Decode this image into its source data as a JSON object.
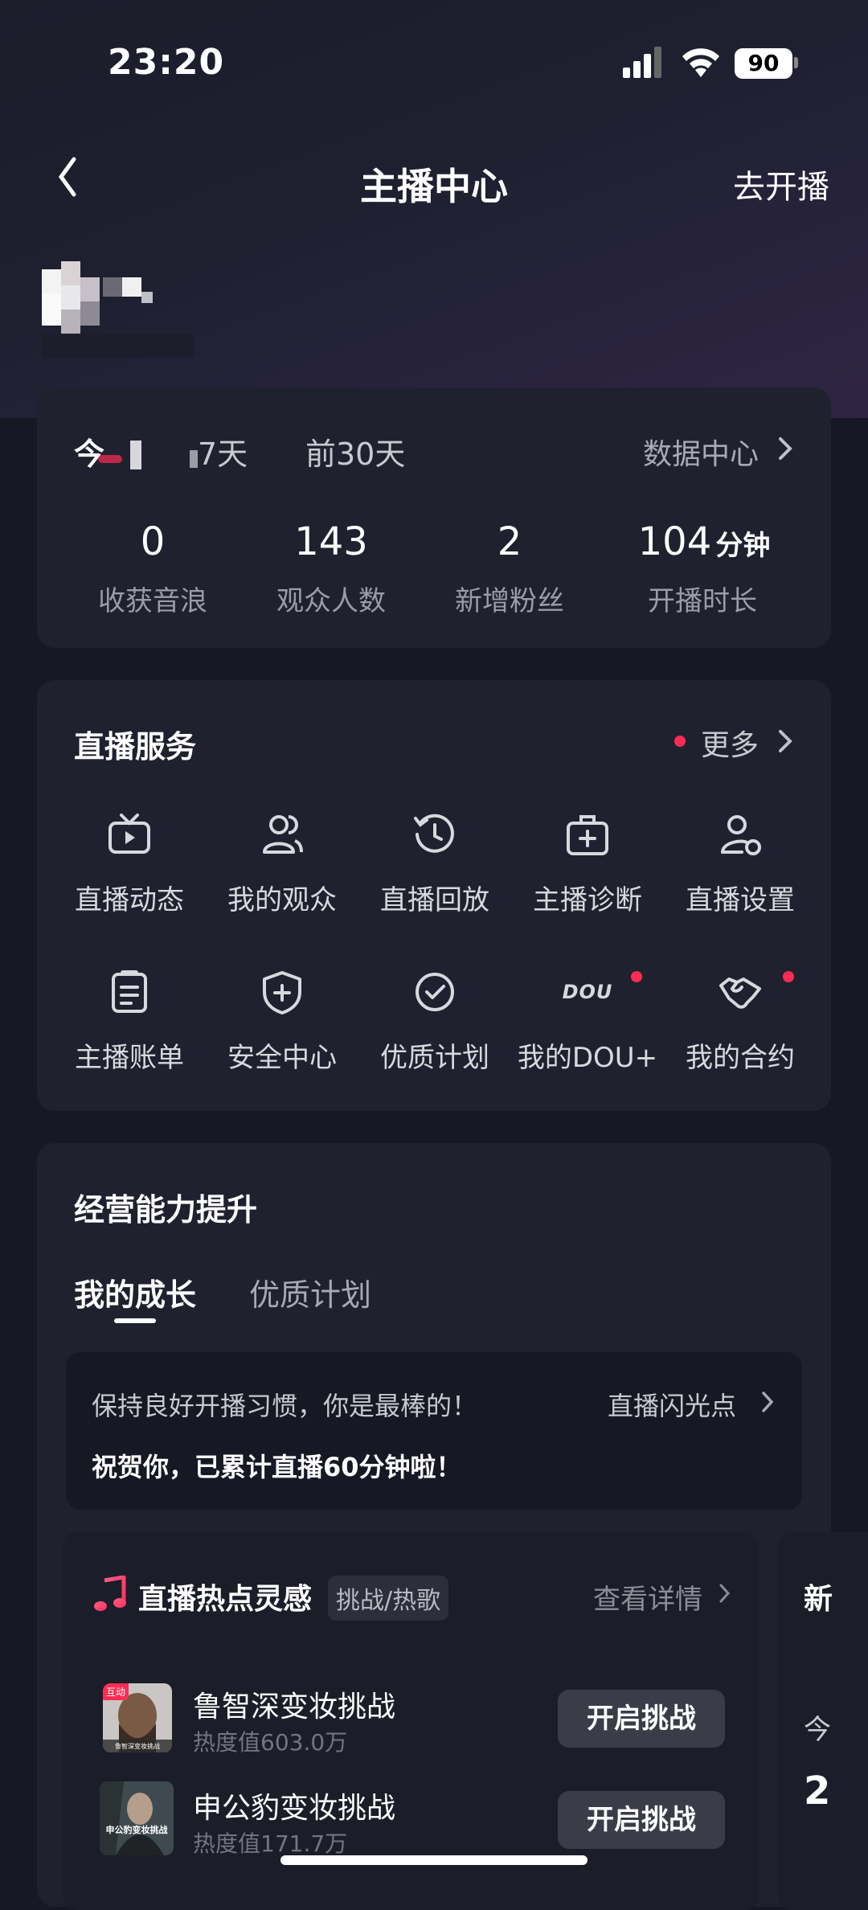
{
  "status_bar": {
    "time": "23:20",
    "battery": "90"
  },
  "nav": {
    "title": "主播中心",
    "action": "去开播"
  },
  "data_card": {
    "tabs": [
      "今日",
      "近7天",
      "前30天"
    ],
    "tab_partial": [
      "今",
      "7天"
    ],
    "data_center": "数据中心",
    "stats": [
      {
        "value": "0",
        "unit": "",
        "label": "收获音浪"
      },
      {
        "value": "143",
        "unit": "",
        "label": "观众人数"
      },
      {
        "value": "2",
        "unit": "",
        "label": "新增粉丝"
      },
      {
        "value": "104",
        "unit": "分钟",
        "label": "开播时长"
      }
    ]
  },
  "services": {
    "title": "直播服务",
    "more": "更多",
    "items": [
      {
        "label": "直播动态",
        "icon": "tv-icon"
      },
      {
        "label": "我的观众",
        "icon": "users-icon"
      },
      {
        "label": "直播回放",
        "icon": "replay-icon"
      },
      {
        "label": "主播诊断",
        "icon": "medical-kit-icon"
      },
      {
        "label": "直播设置",
        "icon": "user-settings-icon"
      },
      {
        "label": "主播账单",
        "icon": "bill-icon"
      },
      {
        "label": "安全中心",
        "icon": "shield-icon"
      },
      {
        "label": "优质计划",
        "icon": "check-circle-icon"
      },
      {
        "label": "我的DOU+",
        "icon": "dou-icon",
        "icon_text": "DOU"
      },
      {
        "label": "我的合约",
        "icon": "handshake-icon"
      }
    ]
  },
  "growth": {
    "title": "经营能力提升",
    "tabs": [
      "我的成长",
      "优质计划"
    ],
    "message1": "保持良好开播习惯，你是最棒的！",
    "highlight_link": "直播闪光点",
    "message2": "祝贺你，已累计直播60分钟啦！"
  },
  "hot": {
    "title": "直播热点灵感",
    "tag": "挑战/热歌",
    "detail_link": "查看详情",
    "items": [
      {
        "title": "鲁智深变妆挑战",
        "heat": "热度值603.0万",
        "button": "开启挑战",
        "badge": "互动",
        "thumb_caption": "鲁智深变妆挑战"
      },
      {
        "title": "申公豹变妆挑战",
        "heat": "热度值171.7万",
        "button": "开启挑战",
        "thumb_caption": "申公豹变妆挑战"
      }
    ],
    "side_panel": {
      "title": "新",
      "today": "今",
      "value": "2"
    }
  },
  "colors": {
    "background": "#161823",
    "card": "#1f212e",
    "accent_red": "#fe2c55"
  }
}
